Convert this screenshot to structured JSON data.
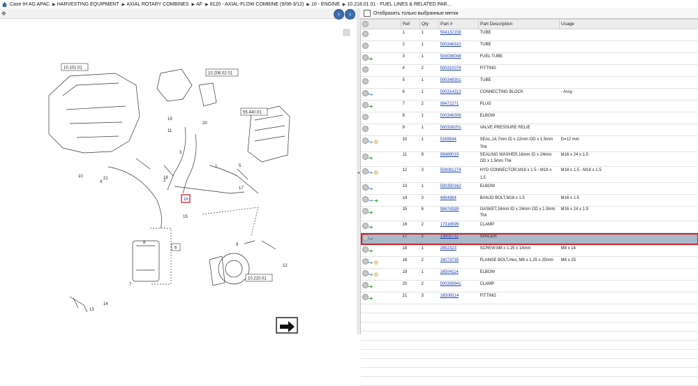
{
  "breadcrumb": [
    "Case IH AG APAC",
    "HARVESTING EQUIPMENT",
    "AXIAL ROTARY COMBINES",
    "AF",
    "8120 - AXIAL-FLOW COMBINE (9/08-3/12)",
    "10 - ENGINE",
    "10.218.01 01 - FUEL LINES & RELATED PAR..."
  ],
  "filter_label": "Отобразить только выбранные метки",
  "table": {
    "headers": [
      "Ref",
      "Qty",
      "Part #",
      "Part Description",
      "Usage"
    ],
    "rows": [
      {
        "ref": "1",
        "qty": "1",
        "part": "504132158",
        "desc": "TUBE",
        "usage": "",
        "icons": []
      },
      {
        "ref": "2",
        "qty": "1",
        "part": "500346310",
        "desc": "TUBE",
        "usage": "",
        "icons": []
      },
      {
        "ref": "3",
        "qty": "1",
        "part": "504036044",
        "desc": "FUEL TUBE",
        "usage": "",
        "icons": [
          "arrow"
        ]
      },
      {
        "ref": "4",
        "qty": "2",
        "part": "500310076",
        "desc": "FITTING",
        "usage": "",
        "icons": []
      },
      {
        "ref": "5",
        "qty": "1",
        "part": "500348301",
        "desc": "TUBE",
        "usage": "",
        "icons": []
      },
      {
        "ref": "6",
        "qty": "1",
        "part": "500314313",
        "desc": "CONNECTING BLOCK",
        "usage": "- Assy",
        "icons": [
          "blue"
        ]
      },
      {
        "ref": "7",
        "qty": "2",
        "part": "98472271",
        "desc": "PLUG",
        "usage": "",
        "icons": [
          "arrow"
        ]
      },
      {
        "ref": "8",
        "qty": "1",
        "part": "500346306",
        "desc": "ELBOW",
        "usage": "",
        "icons": []
      },
      {
        "ref": "9",
        "qty": "1",
        "part": "500328251",
        "desc": "VALVE PRESSURE RELIE",
        "usage": "",
        "icons": []
      },
      {
        "ref": "10",
        "qty": "1",
        "part": "5169544",
        "desc": "SEAL,14.7mm ID x 22mm OD x 1.5mm Thk",
        "usage": "D=12 mm",
        "icons": [
          "blue",
          "gold"
        ]
      },
      {
        "ref": "11",
        "qty": "9",
        "part": "99489019",
        "desc": "SEALING WASHER,16mm ID x 24mm OD x 1.5mm Thk",
        "usage": "M16 x 24 x 1.5",
        "icons": [
          "arrow"
        ],
        "tall": true
      },
      {
        "ref": "12",
        "qty": "3",
        "part": "504081274",
        "desc": "HYD CONNECTOR,M16 x 1.5 - M18 x 1.5",
        "usage": "M16 x 1.5 - M18 x 1.5",
        "icons": [
          "blue",
          "gold"
        ]
      },
      {
        "ref": "13",
        "qty": "1",
        "part": "500350162",
        "desc": "ELBOW",
        "usage": "",
        "icons": [
          "blue"
        ]
      },
      {
        "ref": "14",
        "qty": "3",
        "part": "4864884",
        "desc": "BANJO BOLT,M16 x 1.5",
        "usage": "M16 x 1.5",
        "icons": [
          "blue",
          "arrow"
        ]
      },
      {
        "ref": "15",
        "qty": "6",
        "part": "98474399",
        "desc": "GASKET,16mm ID x 24mm OD x 1.9mm Thk",
        "usage": "M16 x 24 x 1.9",
        "icons": [
          "arrow"
        ],
        "tall": true
      },
      {
        "ref": "16",
        "qty": "2",
        "part": "17316599",
        "desc": "CLAMP",
        "usage": "",
        "icons": [
          "arrow"
        ]
      },
      {
        "ref": "17",
        "qty": "2",
        "part": "13605711",
        "desc": "SPACER",
        "usage": "",
        "icons": [
          "blue"
        ],
        "selected": true
      },
      {
        "ref": "18",
        "qty": "1",
        "part": "2852323",
        "desc": "SCREW,M8 x 1.25  x 14mm",
        "usage": "M8 x 14",
        "icons": [
          "arrow"
        ]
      },
      {
        "ref": "18",
        "qty": "2",
        "part": "16073735",
        "desc": "FLANGE BOLT,Hex, M8 x 1.25 x 25mm",
        "usage": "M8 x 25",
        "icons": [
          "blue",
          "gold"
        ]
      },
      {
        "ref": "19",
        "qty": "1",
        "part": "16504114",
        "desc": "ELBOW",
        "usage": "",
        "icons": [
          "blue",
          "gold"
        ]
      },
      {
        "ref": "20",
        "qty": "2",
        "part": "500306941",
        "desc": "CLAMP",
        "usage": "",
        "icons": [
          "arrow"
        ]
      },
      {
        "ref": "21",
        "qty": "3",
        "part": "16508314",
        "desc": "FITTING",
        "usage": "",
        "icons": [
          "arrow"
        ]
      }
    ]
  },
  "diagram_labels": {
    "ref_a": "10.101.01",
    "ref_b": "10.206.02 01",
    "ref_c": "55.440.01",
    "ref_d": "10.210.01",
    "ref_e": "6",
    "callouts": [
      "1",
      "2",
      "3",
      "4",
      "5",
      "7",
      "8",
      "9",
      "10",
      "11",
      "12",
      "13",
      "14",
      "15",
      "16",
      "17",
      "18",
      "19",
      "20",
      "21"
    ]
  },
  "colors": {
    "selection_border": "#d0202a",
    "selection_fill": "#a9b9c9",
    "link": "#1a3fb0",
    "nav_button": "#3a6db0"
  }
}
